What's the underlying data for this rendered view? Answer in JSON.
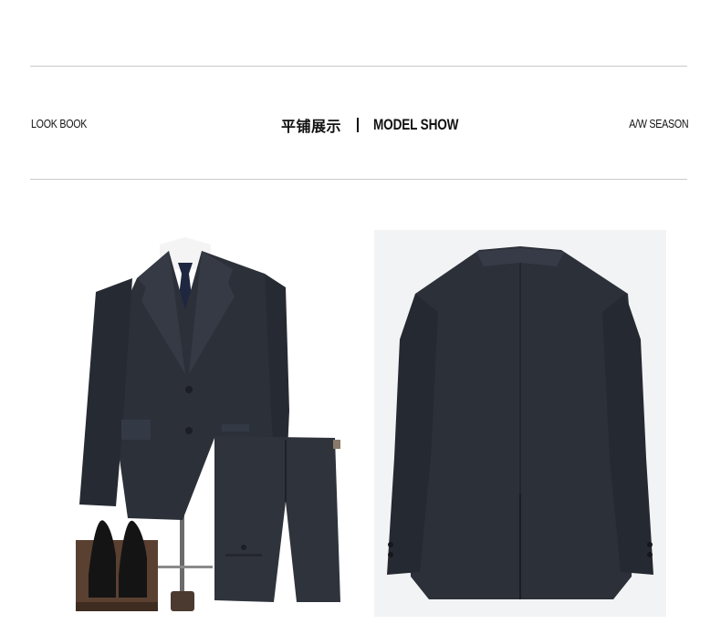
{
  "header": {
    "left_label": "LOOK BOOK",
    "center_cn": "平铺展示",
    "center_en": "MODEL SHOW",
    "right_label": "A/W SEASON"
  },
  "colors": {
    "suit": "#2c3039",
    "rule": "#c9c9c9",
    "back_bg": "#f2f3f5"
  }
}
